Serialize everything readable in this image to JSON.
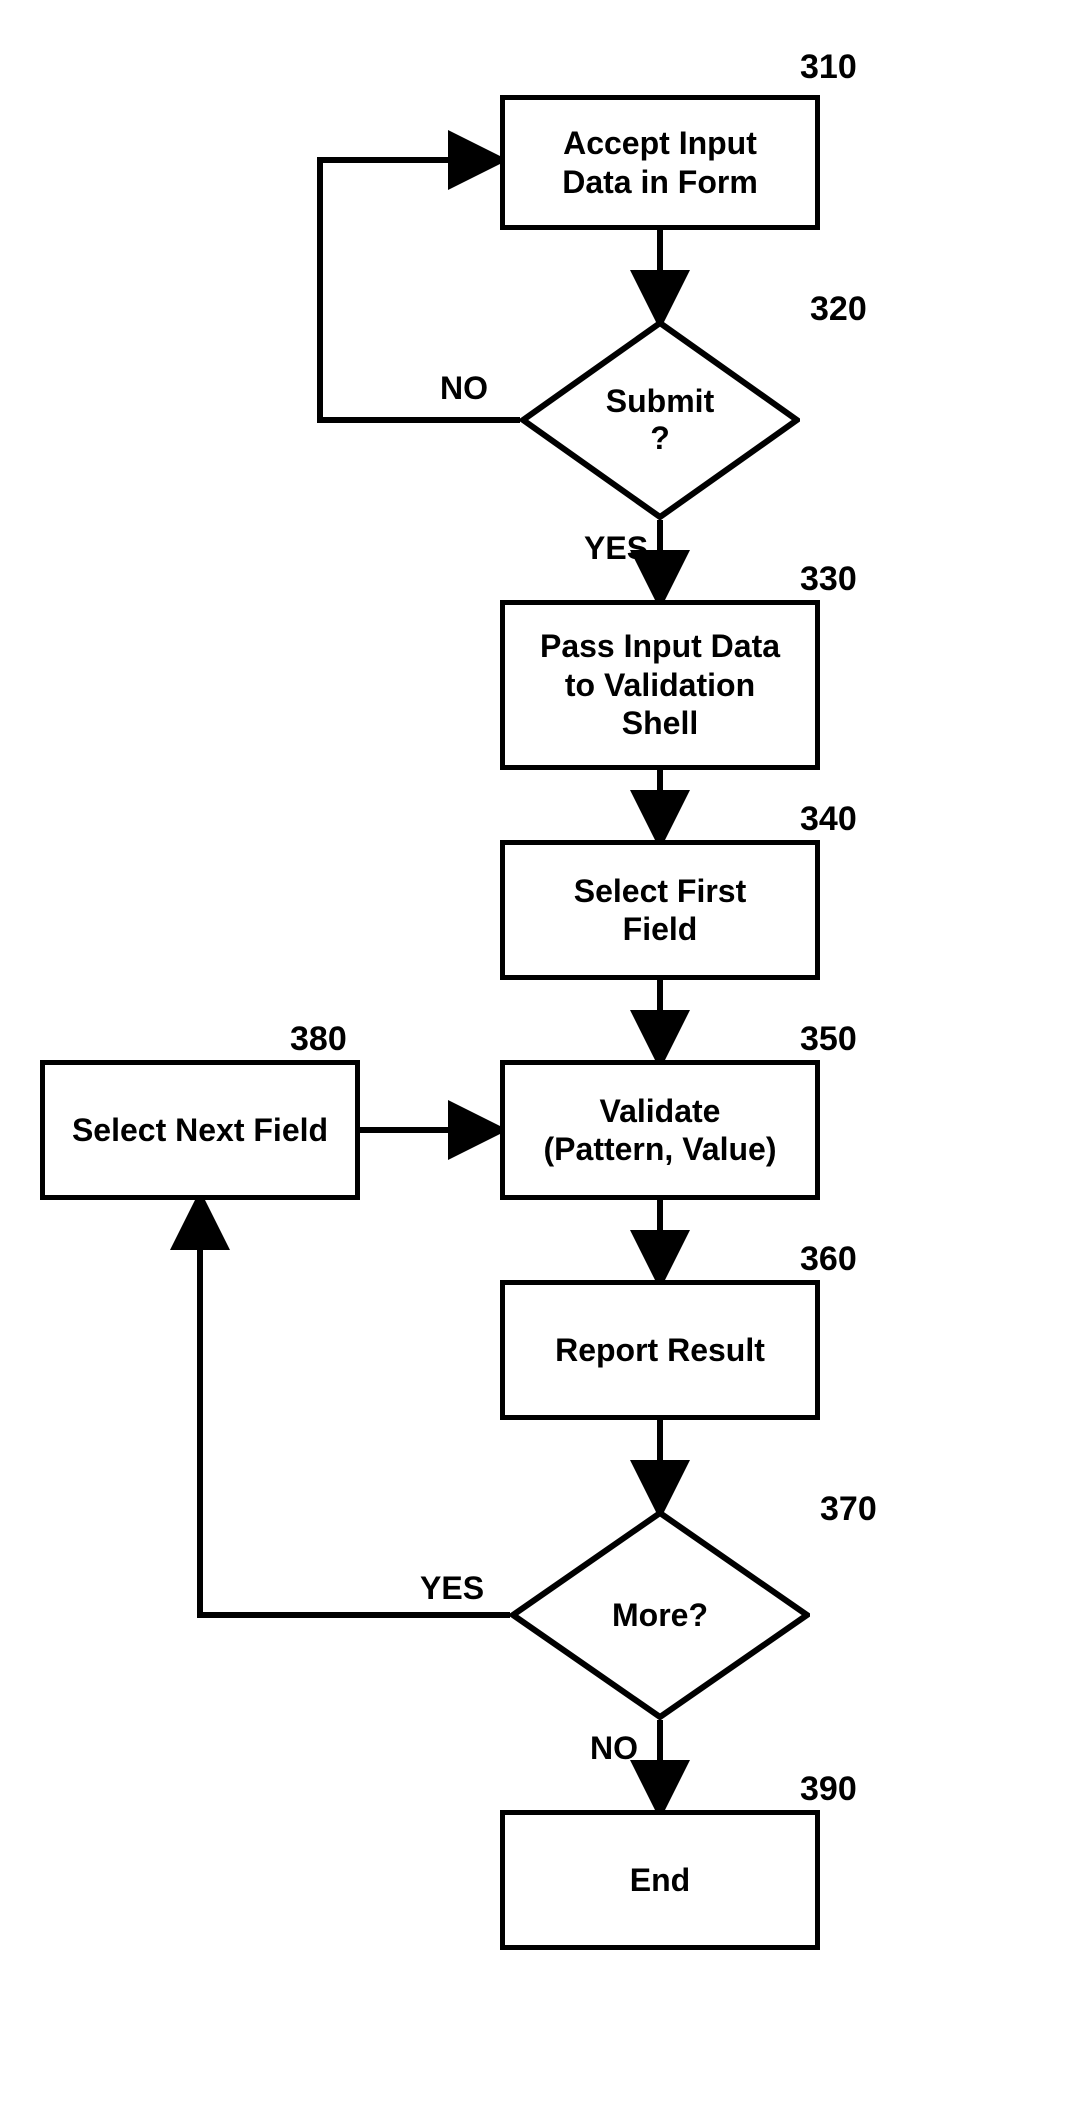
{
  "nodes": {
    "n310": {
      "num": "310",
      "label": "Accept Input\nData in Form"
    },
    "n320": {
      "num": "320",
      "label": "Submit\n?"
    },
    "n330": {
      "num": "330",
      "label": "Pass Input Data\nto Validation\nShell"
    },
    "n340": {
      "num": "340",
      "label": "Select First\nField"
    },
    "n350": {
      "num": "350",
      "label": "Validate\n(Pattern, Value)"
    },
    "n360": {
      "num": "360",
      "label": "Report Result"
    },
    "n370": {
      "num": "370",
      "label": "More?"
    },
    "n380": {
      "num": "380",
      "label": "Select Next Field"
    },
    "n390": {
      "num": "390",
      "label": "End"
    }
  },
  "edges": {
    "yes1": "YES",
    "no1": "NO",
    "yes2": "YES",
    "no2": "NO"
  },
  "chart_data": {
    "type": "flowchart",
    "nodes": [
      {
        "id": "310",
        "shape": "process",
        "text": "Accept Input Data in Form"
      },
      {
        "id": "320",
        "shape": "decision",
        "text": "Submit ?"
      },
      {
        "id": "330",
        "shape": "process",
        "text": "Pass Input Data to Validation Shell"
      },
      {
        "id": "340",
        "shape": "process",
        "text": "Select First Field"
      },
      {
        "id": "350",
        "shape": "process",
        "text": "Validate (Pattern, Value)"
      },
      {
        "id": "360",
        "shape": "process",
        "text": "Report Result"
      },
      {
        "id": "370",
        "shape": "decision",
        "text": "More?"
      },
      {
        "id": "380",
        "shape": "process",
        "text": "Select Next Field"
      },
      {
        "id": "390",
        "shape": "process",
        "text": "End"
      }
    ],
    "edges": [
      {
        "from": "310",
        "to": "320",
        "label": ""
      },
      {
        "from": "320",
        "to": "330",
        "label": "YES"
      },
      {
        "from": "320",
        "to": "310",
        "label": "NO"
      },
      {
        "from": "330",
        "to": "340",
        "label": ""
      },
      {
        "from": "340",
        "to": "350",
        "label": ""
      },
      {
        "from": "350",
        "to": "360",
        "label": ""
      },
      {
        "from": "360",
        "to": "370",
        "label": ""
      },
      {
        "from": "370",
        "to": "380",
        "label": "YES"
      },
      {
        "from": "370",
        "to": "390",
        "label": "NO"
      },
      {
        "from": "380",
        "to": "350",
        "label": ""
      }
    ]
  }
}
